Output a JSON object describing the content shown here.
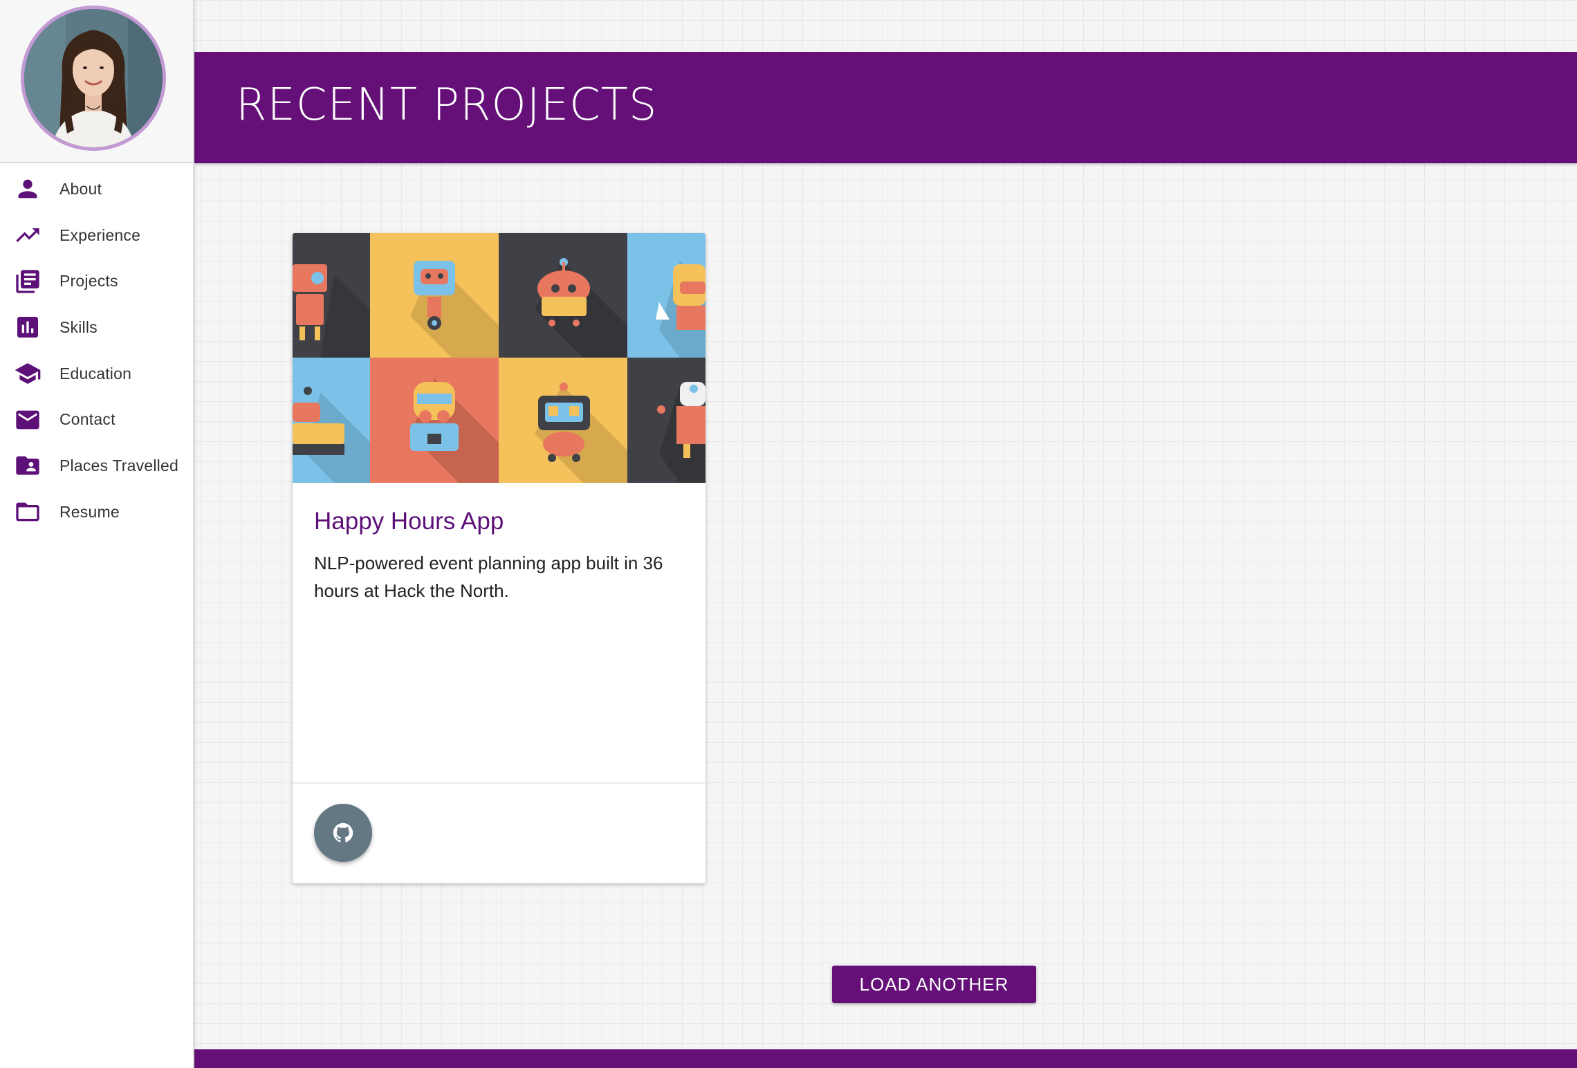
{
  "sidebar": {
    "items": [
      {
        "label": "About",
        "icon": "person-icon"
      },
      {
        "label": "Experience",
        "icon": "trending-up-icon"
      },
      {
        "label": "Projects",
        "icon": "library-books-icon"
      },
      {
        "label": "Skills",
        "icon": "bar-chart-icon"
      },
      {
        "label": "Education",
        "icon": "school-icon"
      },
      {
        "label": "Contact",
        "icon": "mail-icon"
      },
      {
        "label": "Places Travelled",
        "icon": "folder-shared-icon"
      },
      {
        "label": "Resume",
        "icon": "folder-open-icon"
      }
    ]
  },
  "header": {
    "title": "RECENT PROJECTS"
  },
  "card": {
    "title": "Happy Hours App",
    "description": "NLP-powered event planning app built in 36 hours at Hack the North.",
    "action_icon": "github-icon"
  },
  "load_button": {
    "label": "LOAD ANOTHER"
  },
  "colors": {
    "primary": "#641078",
    "accent_border": "#c39ad4",
    "fab": "#637883"
  }
}
